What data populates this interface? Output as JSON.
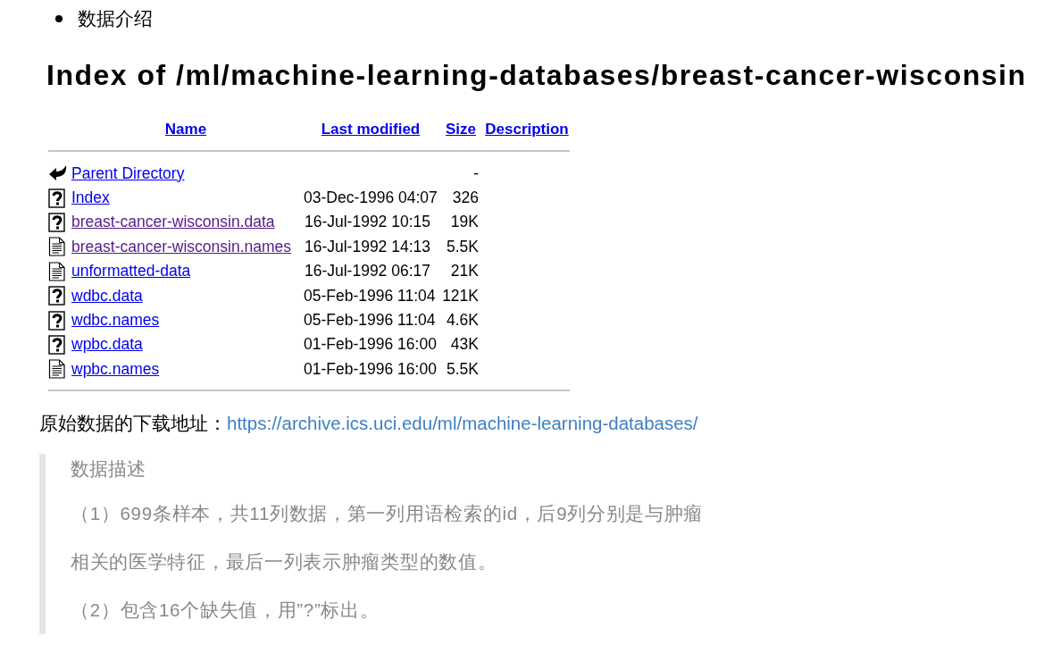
{
  "bullet_list": [
    "数据介绍"
  ],
  "index": {
    "heading": "Index of /ml/machine-learning-databases/breast-cancer-wisconsin",
    "columns": [
      "Name",
      "Last modified",
      "Size",
      "Description"
    ],
    "rows": [
      {
        "kind": "back",
        "name": "Parent Directory",
        "visited": false,
        "size": "-"
      },
      {
        "kind": "unknown",
        "name": "Index",
        "visited": false,
        "last_modified": "03-Dec-1996 04:07",
        "size": "326"
      },
      {
        "kind": "unknown",
        "name": "breast-cancer-wisconsin.data",
        "visited": true,
        "last_modified": "16-Jul-1992 10:15",
        "size": "19K"
      },
      {
        "kind": "text",
        "name": "breast-cancer-wisconsin.names",
        "visited": true,
        "last_modified": "16-Jul-1992 14:13",
        "size": "5.5K"
      },
      {
        "kind": "text",
        "name": "unformatted-data",
        "visited": false,
        "last_modified": "16-Jul-1992 06:17",
        "size": "21K"
      },
      {
        "kind": "unknown",
        "name": "wdbc.data",
        "visited": false,
        "last_modified": "05-Feb-1996 11:04",
        "size": "121K"
      },
      {
        "kind": "unknown",
        "name": "wdbc.names",
        "visited": false,
        "last_modified": "05-Feb-1996 11:04",
        "size": "4.6K"
      },
      {
        "kind": "unknown",
        "name": "wpbc.data",
        "visited": false,
        "last_modified": "01-Feb-1996 16:00",
        "size": "43K"
      },
      {
        "kind": "text",
        "name": "wpbc.names",
        "visited": false,
        "last_modified": "01-Feb-1996 16:00",
        "size": "5.5K"
      }
    ]
  },
  "download": {
    "label": "原始数据的下载地址：",
    "link": "https://archive.ics.uci.edu/ml/machine-learning-databases/"
  },
  "blockquote": {
    "title": "数据描述",
    "paragraphs": [
      "（1）699条样本，共11列数据，第一列用语检索的id，后9列分别是与肿瘤相关的医学特征，最后一列表示肿瘤类型的数值。",
      "（2）包含16个缺失值，用”?”标出。"
    ]
  }
}
